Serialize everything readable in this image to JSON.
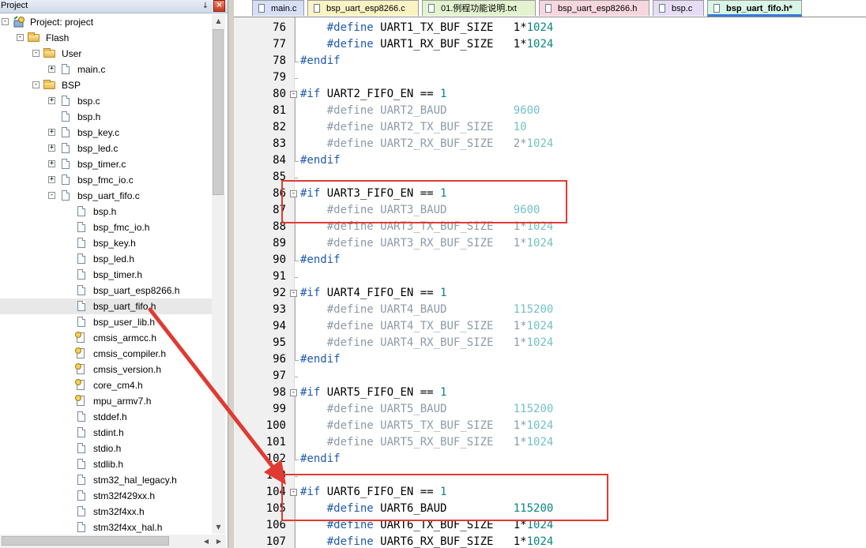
{
  "project_pane": {
    "title": "Project",
    "pin_glyph": "↓",
    "close_glyph": "×",
    "tree": [
      {
        "label": "Project: project",
        "icon": "target-icon",
        "toggle": "-"
      },
      {
        "label": "Flash",
        "icon": "folder-icon",
        "toggle": "-"
      },
      {
        "label": "User",
        "icon": "folder-icon",
        "toggle": "-"
      },
      {
        "label": "main.c",
        "icon": "file-icon",
        "toggle": "+"
      },
      {
        "label": "BSP",
        "icon": "folder-icon",
        "toggle": "-"
      },
      {
        "label": "bsp.c",
        "icon": "file-icon",
        "toggle": "+"
      },
      {
        "label": "bsp.h",
        "icon": "file-icon",
        "toggle": ""
      },
      {
        "label": "bsp_key.c",
        "icon": "file-icon",
        "toggle": "+"
      },
      {
        "label": "bsp_led.c",
        "icon": "file-icon",
        "toggle": "+"
      },
      {
        "label": "bsp_timer.c",
        "icon": "file-icon",
        "toggle": "+"
      },
      {
        "label": "bsp_fmc_io.c",
        "icon": "file-icon",
        "toggle": "+"
      },
      {
        "label": "bsp_uart_fifo.c",
        "icon": "file-icon",
        "toggle": "-"
      },
      {
        "label": "bsp.h",
        "icon": "file-icon",
        "toggle": ""
      },
      {
        "label": "bsp_fmc_io.h",
        "icon": "file-icon",
        "toggle": ""
      },
      {
        "label": "bsp_key.h",
        "icon": "file-icon",
        "toggle": ""
      },
      {
        "label": "bsp_led.h",
        "icon": "file-icon",
        "toggle": ""
      },
      {
        "label": "bsp_timer.h",
        "icon": "file-icon",
        "toggle": ""
      },
      {
        "label": "bsp_uart_esp8266.h",
        "icon": "file-icon",
        "toggle": ""
      },
      {
        "label": "bsp_uart_fifo.h",
        "icon": "file-icon",
        "toggle": "",
        "selected": true
      },
      {
        "label": "bsp_user_lib.h",
        "icon": "file-icon",
        "toggle": ""
      },
      {
        "label": "cmsis_armcc.h",
        "icon": "lib-file-icon",
        "toggle": ""
      },
      {
        "label": "cmsis_compiler.h",
        "icon": "lib-file-icon",
        "toggle": ""
      },
      {
        "label": "cmsis_version.h",
        "icon": "lib-file-icon",
        "toggle": ""
      },
      {
        "label": "core_cm4.h",
        "icon": "lib-file-icon",
        "toggle": ""
      },
      {
        "label": "mpu_armv7.h",
        "icon": "lib-file-icon",
        "toggle": ""
      },
      {
        "label": "stddef.h",
        "icon": "file-icon",
        "toggle": ""
      },
      {
        "label": "stdint.h",
        "icon": "file-icon",
        "toggle": ""
      },
      {
        "label": "stdio.h",
        "icon": "file-icon",
        "toggle": ""
      },
      {
        "label": "stdlib.h",
        "icon": "file-icon",
        "toggle": ""
      },
      {
        "label": "stm32_hal_legacy.h",
        "icon": "file-icon",
        "toggle": ""
      },
      {
        "label": "stm32f429xx.h",
        "icon": "file-icon",
        "toggle": ""
      },
      {
        "label": "stm32f4xx.h",
        "icon": "file-icon",
        "toggle": ""
      },
      {
        "label": "stm32f4xx_hal.h",
        "icon": "file-icon",
        "toggle": ""
      }
    ]
  },
  "tabs": [
    {
      "label": "main.c",
      "color": "#d6dff5"
    },
    {
      "label": "bsp_uart_esp8266.c",
      "color": "#fbf3c4"
    },
    {
      "label": "01.例程功能说明.txt",
      "color": "#e4f3cf"
    },
    {
      "label": "bsp_uart_esp8266.h",
      "color": "#f7d6de"
    },
    {
      "label": "bsp.c",
      "color": "#e6dcf5"
    },
    {
      "label": "bsp_uart_fifo.h*",
      "color": "#d9f5e6",
      "active": true
    }
  ],
  "editor": {
    "lines": [
      {
        "n": "76",
        "fold": "",
        "tokens": [
          [
            "    ",
            ""
          ],
          [
            "#define",
            "kw"
          ],
          [
            " UART1_TX_BUF_SIZE   ",
            "id"
          ],
          [
            "1",
            "id"
          ],
          [
            "*",
            "id"
          ],
          [
            "1024",
            "num"
          ]
        ]
      },
      {
        "n": "77",
        "fold": "",
        "tokens": [
          [
            "    ",
            ""
          ],
          [
            "#define",
            "kw"
          ],
          [
            " UART1_RX_BUF_SIZE   ",
            "id"
          ],
          [
            "1",
            "id"
          ],
          [
            "*",
            "id"
          ],
          [
            "1024",
            "num"
          ]
        ]
      },
      {
        "n": "78",
        "fold": "end",
        "tokens": [
          [
            "#endif",
            "kw"
          ]
        ]
      },
      {
        "n": "79",
        "fold": "",
        "tokens": []
      },
      {
        "n": "80",
        "fold": "start",
        "tokens": [
          [
            "#if",
            "kw"
          ],
          [
            " UART2_FIFO_EN == ",
            "id"
          ],
          [
            "1",
            "num"
          ]
        ]
      },
      {
        "n": "81",
        "fold": "",
        "tokens": [
          [
            "    ",
            ""
          ],
          [
            "#define",
            "kw-g"
          ],
          [
            " UART2_BAUD          ",
            "id-g"
          ],
          [
            "9600",
            "num-g"
          ]
        ]
      },
      {
        "n": "82",
        "fold": "",
        "tokens": [
          [
            "    ",
            ""
          ],
          [
            "#define",
            "kw-g"
          ],
          [
            " UART2_TX_BUF_SIZE   ",
            "id-g"
          ],
          [
            "10",
            "num-g"
          ]
        ]
      },
      {
        "n": "83",
        "fold": "",
        "tokens": [
          [
            "    ",
            ""
          ],
          [
            "#define",
            "kw-g"
          ],
          [
            " UART2_RX_BUF_SIZE   ",
            "id-g"
          ],
          [
            "2*",
            "id-g"
          ],
          [
            "1024",
            "num-g"
          ]
        ]
      },
      {
        "n": "84",
        "fold": "end",
        "tokens": [
          [
            "#endif",
            "kw"
          ]
        ]
      },
      {
        "n": "85",
        "fold": "",
        "tokens": []
      },
      {
        "n": "86",
        "fold": "start",
        "tokens": [
          [
            "#if",
            "kw"
          ],
          [
            " UART3_FIFO_EN == ",
            "id"
          ],
          [
            "1",
            "num"
          ]
        ]
      },
      {
        "n": "87",
        "fold": "",
        "tokens": [
          [
            "    ",
            ""
          ],
          [
            "#define",
            "kw-g"
          ],
          [
            " UART3_BAUD          ",
            "id-g"
          ],
          [
            "9600",
            "num-g"
          ]
        ]
      },
      {
        "n": "88",
        "fold": "",
        "tokens": [
          [
            "    ",
            ""
          ],
          [
            "#define",
            "kw-g"
          ],
          [
            " UART3_TX_BUF_SIZE   ",
            "id-g"
          ],
          [
            "1*",
            "id-g"
          ],
          [
            "1024",
            "num-g"
          ]
        ]
      },
      {
        "n": "89",
        "fold": "",
        "tokens": [
          [
            "    ",
            ""
          ],
          [
            "#define",
            "kw-g"
          ],
          [
            " UART3_RX_BUF_SIZE   ",
            "id-g"
          ],
          [
            "1*",
            "id-g"
          ],
          [
            "1024",
            "num-g"
          ]
        ]
      },
      {
        "n": "90",
        "fold": "end",
        "tokens": [
          [
            "#endif",
            "kw"
          ]
        ]
      },
      {
        "n": "91",
        "fold": "",
        "tokens": []
      },
      {
        "n": "92",
        "fold": "start",
        "tokens": [
          [
            "#if",
            "kw"
          ],
          [
            " UART4_FIFO_EN == ",
            "id"
          ],
          [
            "1",
            "num"
          ]
        ]
      },
      {
        "n": "93",
        "fold": "",
        "tokens": [
          [
            "    ",
            ""
          ],
          [
            "#define",
            "kw-g"
          ],
          [
            " UART4_BAUD          ",
            "id-g"
          ],
          [
            "115200",
            "num-g"
          ]
        ]
      },
      {
        "n": "94",
        "fold": "",
        "tokens": [
          [
            "    ",
            ""
          ],
          [
            "#define",
            "kw-g"
          ],
          [
            " UART4_TX_BUF_SIZE   ",
            "id-g"
          ],
          [
            "1*",
            "id-g"
          ],
          [
            "1024",
            "num-g"
          ]
        ]
      },
      {
        "n": "95",
        "fold": "",
        "tokens": [
          [
            "    ",
            ""
          ],
          [
            "#define",
            "kw-g"
          ],
          [
            " UART4_RX_BUF_SIZE   ",
            "id-g"
          ],
          [
            "1*",
            "id-g"
          ],
          [
            "1024",
            "num-g"
          ]
        ]
      },
      {
        "n": "96",
        "fold": "end",
        "tokens": [
          [
            "#endif",
            "kw"
          ]
        ]
      },
      {
        "n": "97",
        "fold": "",
        "tokens": []
      },
      {
        "n": "98",
        "fold": "start",
        "tokens": [
          [
            "#if",
            "kw"
          ],
          [
            " UART5_FIFO_EN == ",
            "id"
          ],
          [
            "1",
            "num"
          ]
        ]
      },
      {
        "n": "99",
        "fold": "",
        "tokens": [
          [
            "    ",
            ""
          ],
          [
            "#define",
            "kw-g"
          ],
          [
            " UART5_BAUD          ",
            "id-g"
          ],
          [
            "115200",
            "num-g"
          ]
        ]
      },
      {
        "n": "100",
        "fold": "",
        "tokens": [
          [
            "    ",
            ""
          ],
          [
            "#define",
            "kw-g"
          ],
          [
            " UART5_TX_BUF_SIZE   ",
            "id-g"
          ],
          [
            "1*",
            "id-g"
          ],
          [
            "1024",
            "num-g"
          ]
        ]
      },
      {
        "n": "101",
        "fold": "",
        "tokens": [
          [
            "    ",
            ""
          ],
          [
            "#define",
            "kw-g"
          ],
          [
            " UART5_RX_BUF_SIZE   ",
            "id-g"
          ],
          [
            "1*",
            "id-g"
          ],
          [
            "1024",
            "num-g"
          ]
        ]
      },
      {
        "n": "102",
        "fold": "end",
        "tokens": [
          [
            "#endif",
            "kw"
          ]
        ]
      },
      {
        "n": "103",
        "fold": "",
        "tokens": []
      },
      {
        "n": "104",
        "fold": "start",
        "tokens": [
          [
            "#if",
            "kw"
          ],
          [
            " UART6_FIFO_EN == ",
            "id"
          ],
          [
            "1",
            "num"
          ]
        ]
      },
      {
        "n": "105",
        "fold": "",
        "tokens": [
          [
            "    ",
            ""
          ],
          [
            "#define",
            "kw"
          ],
          [
            " UART6_BAUD          ",
            "id"
          ],
          [
            "115200",
            "num"
          ]
        ]
      },
      {
        "n": "106",
        "fold": "",
        "tokens": [
          [
            "    ",
            ""
          ],
          [
            "#define",
            "kw"
          ],
          [
            " UART6_TX_BUF_SIZE   ",
            "id"
          ],
          [
            "1*",
            "id"
          ],
          [
            "1024",
            "num"
          ]
        ]
      },
      {
        "n": "107",
        "fold": "",
        "tokens": [
          [
            "    ",
            ""
          ],
          [
            "#define",
            "kw"
          ],
          [
            " UART6_RX_BUF_SIZE   ",
            "id"
          ],
          [
            "1*",
            "id"
          ],
          [
            "1024",
            "num"
          ]
        ]
      }
    ]
  },
  "annotation_color": "#e03a33"
}
